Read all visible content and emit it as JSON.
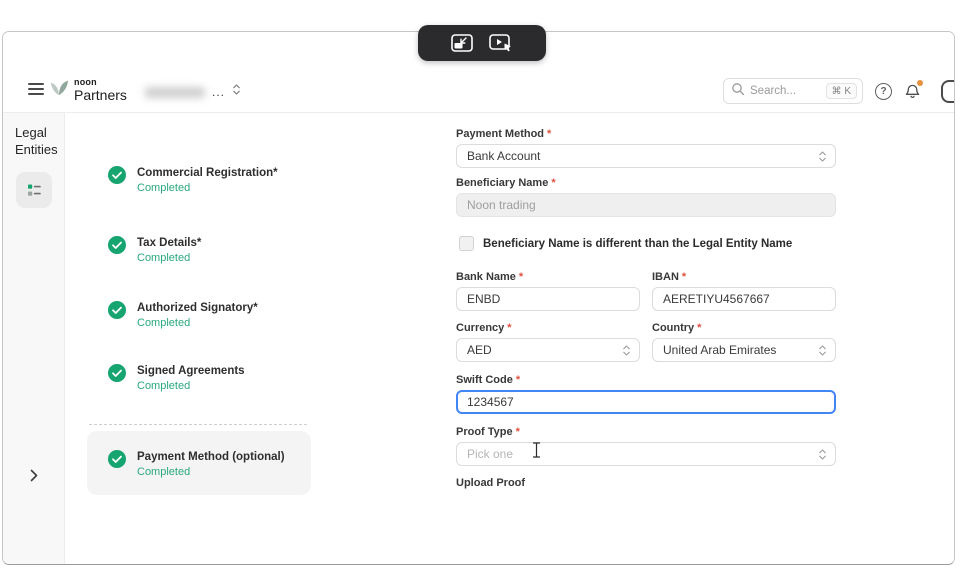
{
  "colors": {
    "success": "#16a571",
    "success-text": "#2aa87d",
    "required": "#e0513f",
    "focus": "#4285f4"
  },
  "header": {
    "brand": {
      "top": "noon",
      "bottom": "Partners"
    },
    "entity_switcher": {
      "ellipsis": "..."
    },
    "search": {
      "placeholder": "Search...",
      "shortcut": "⌘ K"
    },
    "help_label": "?"
  },
  "sidebar": {
    "title_line1": "Legal",
    "title_line2": "Entities"
  },
  "stepper": {
    "items": [
      {
        "label": "Commercial Registration*",
        "status": "Completed"
      },
      {
        "label": "Tax Details*",
        "status": "Completed"
      },
      {
        "label": "Authorized Signatory*",
        "status": "Completed"
      },
      {
        "label": "Signed Agreements",
        "status": "Completed"
      },
      {
        "label": "Payment Method (optional)",
        "status": "Completed"
      }
    ]
  },
  "form": {
    "required_mark": "*",
    "payment_method": {
      "label": "Payment Method",
      "value": "Bank Account"
    },
    "beneficiary_name": {
      "label": "Beneficiary Name",
      "value": "Noon trading"
    },
    "beneficiary_checkbox": "Beneficiary Name is different than the Legal Entity Name",
    "bank_name": {
      "label": "Bank Name",
      "value": "ENBD"
    },
    "iban": {
      "label": "IBAN",
      "value": "AERETIYU4567667"
    },
    "currency": {
      "label": "Currency",
      "value": "AED"
    },
    "country": {
      "label": "Country",
      "value": "United Arab Emirates"
    },
    "swift_code": {
      "label": "Swift Code",
      "value": "1234567"
    },
    "proof_type": {
      "label": "Proof Type",
      "placeholder": "Pick one"
    },
    "upload_proof_label": "Upload Proof"
  }
}
